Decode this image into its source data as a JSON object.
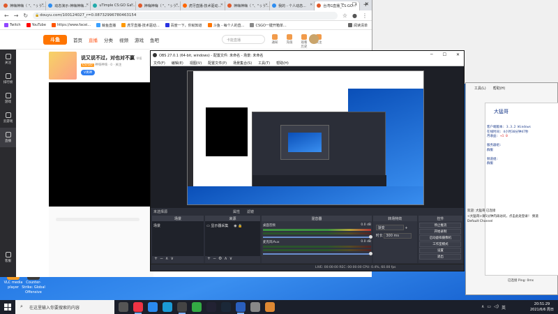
{
  "browser": {
    "tabs": [
      {
        "label": "神嗨神嗨（ \"、\"ぅう..."
      },
      {
        "label": "动态演示-神嗨神嗨..."
      },
      {
        "label": "uTimple CS:GO Ga..."
      },
      {
        "label": "神嗨神嗨（ \"、\"ぅう..."
      },
      {
        "label": "虎牙直播-技术驱动..."
      },
      {
        "label": "神嗨神嗨（ \"、\"ぅう..."
      },
      {
        "label": "我的 - 个人动态..."
      },
      {
        "label": "台湾G直播_CS:GO..."
      }
    ],
    "url": "douyu.com/100124027_r=0.08732996780463154",
    "bookmarks": [
      {
        "label": "Twitch"
      },
      {
        "label": "YouTube"
      },
      {
        "label": "https://www.facei..."
      },
      {
        "label": "鲸鱼直播"
      },
      {
        "label": "虎牙直播-技术驱动..."
      },
      {
        "label": "百度一下，你就知道"
      },
      {
        "label": "斗鱼 - 每个人的直..."
      },
      {
        "label": "CSGO一键开箱单..."
      }
    ],
    "reading_list": "阅读清单"
  },
  "douyu": {
    "logo": "斗鱼",
    "nav": [
      "首页",
      "直播",
      "分类",
      "视频",
      "游戏",
      "鱼吧"
    ],
    "search_placeholder": "卡能直播",
    "header_icons": [
      "通知",
      "充值",
      "观看历史",
      "关注"
    ],
    "sidebar": [
      "关注",
      "排行榜",
      "游戏",
      "云游戏",
      "直播"
    ],
    "sidebar_bottom": "客服",
    "room": {
      "title": "说又说不过，对也对不赢",
      "subtitle": "举报",
      "tag": "CS:GO",
      "meta": "神嗨神嗨 · 0 · 关注",
      "badge": "V男神"
    }
  },
  "obs": {
    "title": "OBS 27.0.1 (64-bit, windows) - 配置文件: 未命名 - 场景: 未命名",
    "menu": [
      "文件(F)",
      "编辑(E)",
      "视图(V)",
      "配置文件(P)",
      "场景集合(S)",
      "工具(T)",
      "帮助(H)"
    ],
    "scene_bar": {
      "no_source": "未选择源",
      "props": "属性",
      "filters": "滤镜"
    },
    "docks": {
      "scenes": "场景",
      "sources": "来源",
      "mixer": "混音器",
      "transitions": "转场特效",
      "controls": "控件"
    },
    "scene_item": "场景",
    "source_item": "显示器采集",
    "mixer_rows": [
      {
        "label": "桌面音频",
        "value": "0.0 dB"
      },
      {
        "label": "麦克风/Aux",
        "value": "0.0 dB"
      },
      {
        "label": "桌面音频",
        "value": "0.0 dB"
      }
    ],
    "transition": {
      "value": "渐变",
      "duration_label": "时长",
      "duration": "300 ms"
    },
    "controls": [
      "停止推流",
      "开始录制",
      "启动虚拟摄像机",
      "工作室模式",
      "设置",
      "退出"
    ],
    "status": "LIVE: 00:00:00   REC: 00:00:00   CPU: 0.4%, 60.00 fps"
  },
  "chat": {
    "menu": [
      "工具(L)",
      "帮助(H)"
    ],
    "name": "大猛哥",
    "info_lines": [
      "客户端版本: 3.3.2 Windows",
      "在线时间: 4小时30分钟47秒",
      "月收益:",
      "服务器组:",
      "群服",
      "频道组:",
      "群服"
    ],
    "online_value": "+1 0",
    "messages": [
      "欢迎: 大猛哥 已连接",
      "<大猛哥>请5分钟内再访问，点击此处登录！ 频道",
      "Default Channel"
    ],
    "bottom_status": "已连接 Ping: 0ms"
  },
  "desktop": {
    "icons": [
      {
        "label": "VLC media player"
      },
      {
        "label": "Counter-Strike: Global Offensive"
      }
    ]
  },
  "taskbar": {
    "search_placeholder": "在这里输入你要搜索的内容",
    "time": "20:51:29",
    "date": "2021/6/6 周日",
    "lang": "英"
  }
}
